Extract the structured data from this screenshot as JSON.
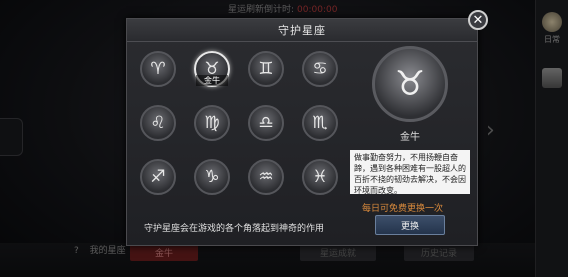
{
  "background": {
    "refresh_label": "星运刷新倒计时:",
    "refresh_value": "00:00:00",
    "my_sign_q": "?",
    "my_sign_label": "我的星座",
    "my_sign_value": "金牛",
    "btn_achievement": "星运成就",
    "btn_history": "历史记录",
    "side_tab_daily": "日常",
    "side_tab_2": "",
    "arrow": "›"
  },
  "modal": {
    "title": "守护星座",
    "close": "✕",
    "zodiac": [
      {
        "name": "aries",
        "glyph": "♈"
      },
      {
        "name": "taurus",
        "glyph": "♉",
        "selected": true,
        "label": "金牛"
      },
      {
        "name": "gemini",
        "glyph": "♊"
      },
      {
        "name": "cancer",
        "glyph": "♋"
      },
      {
        "name": "leo",
        "glyph": "♌"
      },
      {
        "name": "virgo",
        "glyph": "♍"
      },
      {
        "name": "libra",
        "glyph": "♎"
      },
      {
        "name": "scorpio",
        "glyph": "♏"
      },
      {
        "name": "sagittarius",
        "glyph": "♐"
      },
      {
        "name": "capricorn",
        "glyph": "♑"
      },
      {
        "name": "aquarius",
        "glyph": "♒"
      },
      {
        "name": "pisces",
        "glyph": "♓"
      }
    ],
    "selected_glyph": "♉",
    "selected_name": "金牛",
    "description": "做事勤奋努力，不用扬鞭自奋蹄，遇到各种困难有一股超人的百折不挠的韧劲去解决，不会因环境而改变。",
    "free_change_text": "每日可免费更换一次",
    "change_button": "更换",
    "footer_note": "守护星座会在游戏的各个角落起到神奇的作用"
  },
  "colors": {
    "accent_orange": "#d98a3c",
    "button_blue": "#2f4260"
  }
}
